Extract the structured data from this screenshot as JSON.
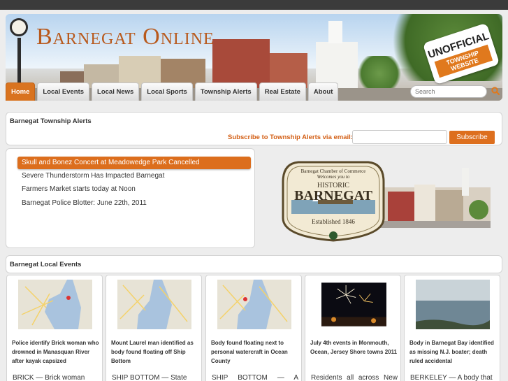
{
  "site": {
    "title": "Barnegat Online",
    "badge_line1": "UNOFFICIAL",
    "badge_line2": "TOWNSHIP WEBSITE"
  },
  "nav": {
    "items": [
      {
        "label": "Home",
        "active": true
      },
      {
        "label": "Local Events"
      },
      {
        "label": "Local News"
      },
      {
        "label": "Local Sports"
      },
      {
        "label": "Township Alerts"
      },
      {
        "label": "Real Estate"
      },
      {
        "label": "About"
      }
    ]
  },
  "search": {
    "placeholder": "Search"
  },
  "alerts": {
    "title": "Barnegat Township Alerts",
    "subscribe_label": "Subscribe to Township Alerts via email:",
    "subscribe_button": "Subscribe"
  },
  "headlines": [
    {
      "text": "Skull and Bonez Concert at Meadowedge Park Cancelled",
      "active": true
    },
    {
      "text": "Severe Thunderstorm Has Impacted Barnegat"
    },
    {
      "text": "Farmers Market starts today at Noon"
    },
    {
      "text": "Barnegat Police Blotter: June 22th, 2011"
    }
  ],
  "logo": {
    "line1": "Barnegat Chamber of Commerce",
    "line2": "Welcomes you to",
    "line3": "HISTORIC",
    "line4": "BARNEGAT",
    "line5": "Established 1846"
  },
  "events": {
    "title": "Barnegat Local Events",
    "cards": [
      {
        "title": "Police identify Brick woman who drowned in Manasquan River after kayak capsized",
        "text": "BRICK — Brick woman",
        "image": "map"
      },
      {
        "title": "Mount Laurel man identified as body found floating off Ship Bottom",
        "text": "SHIP BOTTOM — State",
        "image": "map"
      },
      {
        "title": "Body found floating next to personal watercraft in Ocean County",
        "text": "SHIP BOTTOM — A passing",
        "image": "map"
      },
      {
        "title": "July 4th events in Monmouth, Ocean, Jersey Shore towns 2011",
        "text": "Residents all across New Jersey are getting ready to",
        "image": "fireworks"
      },
      {
        "title": "Body in Barnegat Bay identified as missing N.J. boater; death ruled accidental",
        "text": "BERKELEY — A body that",
        "image": "bay"
      }
    ]
  },
  "colors": {
    "accent": "#dc6e1d",
    "title": "#b8591c"
  }
}
